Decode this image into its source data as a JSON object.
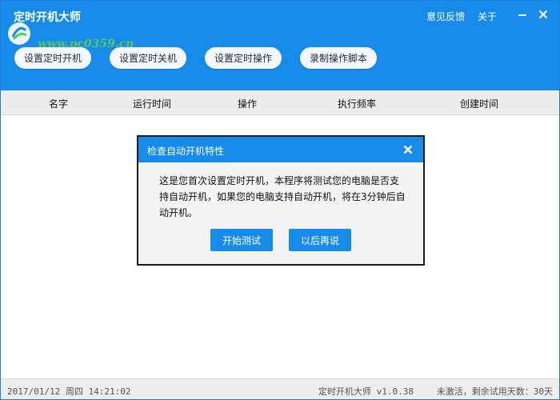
{
  "app": {
    "title": "定时开机大师",
    "watermark": "www.pc0359.cn",
    "links": {
      "feedback": "意见反馈",
      "about": "关于"
    }
  },
  "toolbar": {
    "buttons": [
      "设置定时开机",
      "设置定时关机",
      "设置定时操作",
      "录制操作脚本"
    ]
  },
  "table": {
    "columns": [
      "名字",
      "运行时间",
      "操作",
      "执行频率",
      "创建时间"
    ]
  },
  "status": {
    "datetime": "2017/01/12 周四 14:21:02",
    "version": "定时开机大师 v1.0.38",
    "license": "未激活，剩余试用天数：30天"
  },
  "dialog": {
    "title": "检查自动开机特性",
    "message": "这是您首次设置定时开机，本程序将测试您的电脑是否支持自动开机，如果您的电脑支持自动开机，将在3分钟后自动开机。",
    "start_label": "开始测试",
    "later_label": "以后再说"
  },
  "colors": {
    "accent": "#168be9",
    "header_band": "#ececec"
  }
}
